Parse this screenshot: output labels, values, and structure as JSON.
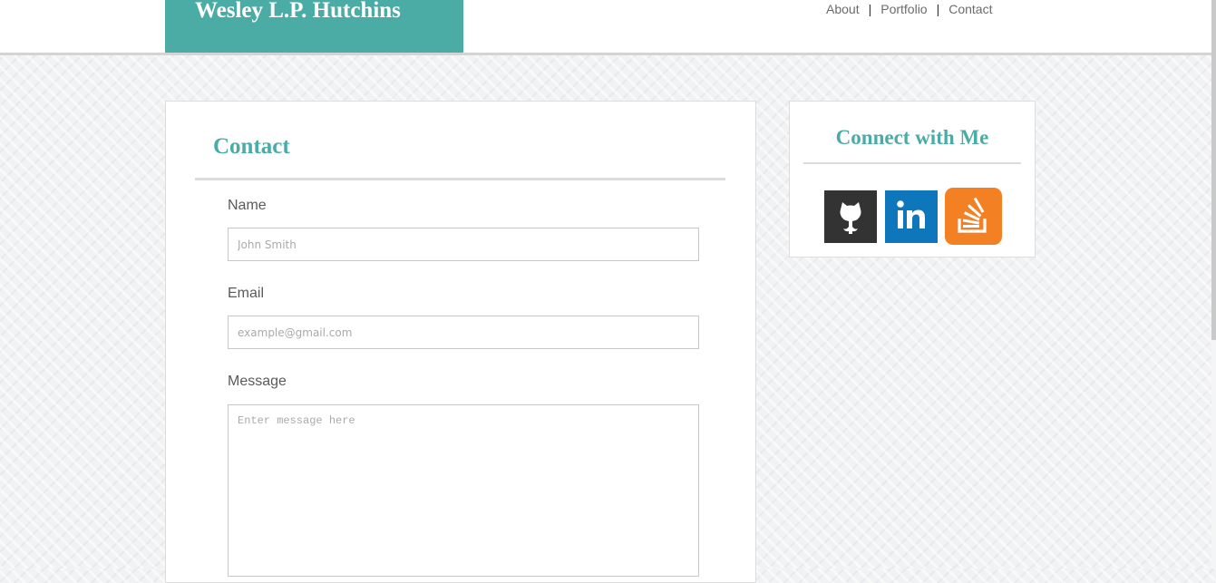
{
  "header": {
    "brand": "Wesley L.P. Hutchins",
    "nav": [
      {
        "label": "About"
      },
      {
        "label": "Portfolio"
      },
      {
        "label": "Contact"
      }
    ],
    "separator": "|"
  },
  "contact": {
    "title": "Contact",
    "name_label": "Name",
    "name_placeholder": "John Smith",
    "email_label": "Email",
    "email_placeholder": "example@gmail.com",
    "message_label": "Message",
    "message_placeholder": "Enter message here"
  },
  "connect": {
    "title": "Connect with Me",
    "links": [
      {
        "icon": "github-icon"
      },
      {
        "icon": "linkedin-icon",
        "color": "#0e76bb"
      },
      {
        "icon": "stackoverflow-icon",
        "color": "#f48024"
      }
    ]
  },
  "colors": {
    "accent": "#4aaca5"
  }
}
